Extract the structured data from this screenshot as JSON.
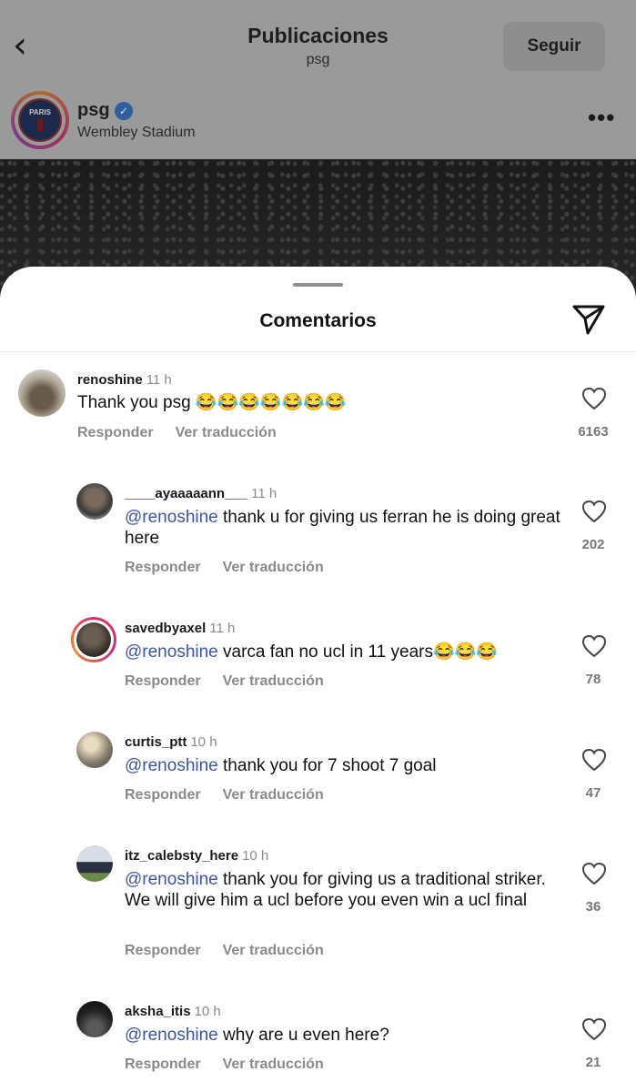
{
  "header": {
    "back_icon": "chevron-left-icon",
    "title": "Publicaciones",
    "subtitle": "psg",
    "follow_label": "Seguir"
  },
  "post": {
    "username": "psg",
    "location": "Wembley Stadium",
    "avatar_text": "PARIS",
    "more_icon": "more-horizontal-icon"
  },
  "sheet": {
    "title": "Comentarios",
    "share_icon": "paper-plane-icon"
  },
  "comments": [
    {
      "username": "renoshine",
      "time": "11 h",
      "mention": "",
      "text": "Thank you psg 😂😂😂😂😂😂😂",
      "reply": "Responder",
      "translate": "Ver traducción",
      "likes": "6163"
    },
    {
      "username": "____ayaaaaann___",
      "time": "11 h",
      "mention": "@renoshine",
      "text": " thank u for giving us ferran he is doing great here",
      "reply": "Responder",
      "translate": "Ver traducción",
      "likes": "202"
    },
    {
      "username": "savedbyaxel",
      "time": "11 h",
      "mention": "@renoshine",
      "text": " varca fan no ucl in 11 years😂😂😂",
      "reply": "Responder",
      "translate": "Ver traducción",
      "likes": "78"
    },
    {
      "username": "curtis_ptt",
      "time": "10 h",
      "mention": "@renoshine",
      "text": " thank you for 7 shoot 7 goal",
      "reply": "Responder",
      "translate": "Ver traducción",
      "likes": "47"
    },
    {
      "username": "itz_calebsty_here",
      "time": "10 h",
      "mention": "@renoshine",
      "text": " thank you for giving us a traditional striker. We will give him a ucl before you even win a ucl final",
      "reply": "Responder",
      "translate": "Ver traducción",
      "likes": "36"
    },
    {
      "username": "aksha_itis",
      "time": "10 h",
      "mention": "@renoshine",
      "text": " why are u even here?",
      "reply": "Responder",
      "translate": "Ver traducción",
      "likes": "21"
    }
  ]
}
